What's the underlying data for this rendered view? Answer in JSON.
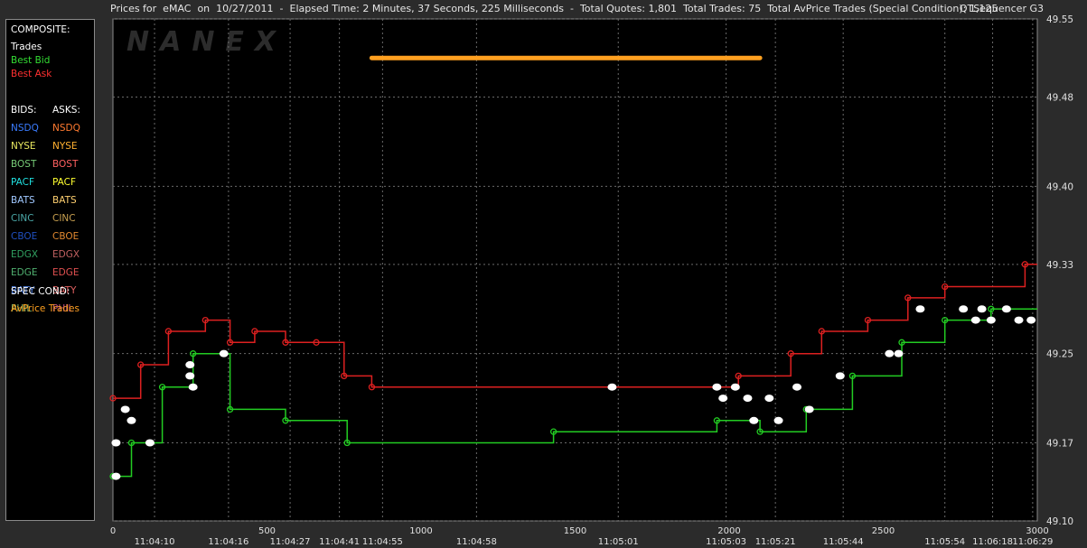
{
  "header": {
    "title": "Prices for  eMAC  on  10/27/2011  -  Elapsed Time: 2 Minutes, 37 Seconds, 225 Milliseconds  -  Total Quotes: 1,801  Total Trades: 75  Total AvPrice Trades (Special Condition): 1,125",
    "app_name": "QTSequencer G3"
  },
  "legend": {
    "composite_label": "COMPOSITE:",
    "composite_items": [
      {
        "label": "Trades",
        "color": "#ffffff"
      },
      {
        "label": "Best Bid",
        "color": "#33dd33"
      },
      {
        "label": "Best Ask",
        "color": "#ff3030"
      }
    ],
    "bids_label": "BIDS:",
    "asks_label": "ASKS:",
    "exchanges": [
      {
        "bid": "NSDQ",
        "bid_color": "#3a7cff",
        "ask": "NSDQ",
        "ask_color": "#ff7a30"
      },
      {
        "bid": "NYSE",
        "bid_color": "#e8e860",
        "ask": "NYSE",
        "ask_color": "#ffb030"
      },
      {
        "bid": "BOST",
        "bid_color": "#77cc77",
        "ask": "BOST",
        "ask_color": "#ff6060"
      },
      {
        "bid": "PACF",
        "bid_color": "#20e0e0",
        "ask": "PACF",
        "ask_color": "#ffff30"
      },
      {
        "bid": "BATS",
        "bid_color": "#a0c8ff",
        "ask": "BATS",
        "ask_color": "#ffd070"
      },
      {
        "bid": "CINC",
        "bid_color": "#4aa6a6",
        "ask": "CINC",
        "ask_color": "#c8a050"
      },
      {
        "bid": "CBOE",
        "bid_color": "#2050c0",
        "ask": "CBOE",
        "ask_color": "#e08830"
      },
      {
        "bid": "EDGX",
        "bid_color": "#30a060",
        "ask": "EDGX",
        "ask_color": "#c06060"
      },
      {
        "bid": "EDGE",
        "bid_color": "#50b070",
        "ask": "EDGE",
        "ask_color": "#e05050"
      },
      {
        "bid": "BATY",
        "bid_color": "#5080e0",
        "ask": "BATY",
        "ask_color": "#e06060"
      },
      {
        "bid": "PHIL",
        "bid_color": "#80b060",
        "ask": "PHIL",
        "ask_color": "#c05080"
      }
    ],
    "spec_cond_label": "SPEC COND:",
    "spec_items": [
      {
        "label": "AvPrice Trades",
        "color": "#ffa020"
      }
    ]
  },
  "watermark": "NANEX",
  "chart_data": {
    "type": "line",
    "ylim": [
      49.1,
      49.55
    ],
    "xlim": [
      0,
      3000
    ],
    "y_ticks": [
      49.55,
      49.48,
      49.4,
      49.33,
      49.25,
      49.17,
      49.1
    ],
    "x_ticks": [
      0,
      500,
      1000,
      1500,
      2000,
      2500,
      3000
    ],
    "time_ticks": [
      {
        "x": 135,
        "label": "11:04:10"
      },
      {
        "x": 375,
        "label": "11:04:16"
      },
      {
        "x": 575,
        "label": "11:04:27"
      },
      {
        "x": 735,
        "label": "11:04:41"
      },
      {
        "x": 875,
        "label": "11:04:55"
      },
      {
        "x": 1180,
        "label": "11:04:58"
      },
      {
        "x": 1640,
        "label": "11:05:01"
      },
      {
        "x": 1990,
        "label": "11:05:03"
      },
      {
        "x": 2150,
        "label": "11:05:21"
      },
      {
        "x": 2370,
        "label": "11:05:44"
      },
      {
        "x": 2700,
        "label": "11:05:54"
      },
      {
        "x": 2855,
        "label": "11:06:18"
      },
      {
        "x": 2985,
        "label": "11:06:29"
      }
    ],
    "grid": true,
    "series": [
      {
        "name": "AvPrice Trades",
        "color": "#ffa020",
        "points": [
          [
            840,
            49.515
          ],
          [
            1180,
            49.515
          ],
          [
            1540,
            49.515
          ],
          [
            1980,
            49.515
          ],
          [
            2100,
            49.515
          ]
        ]
      },
      {
        "name": "Best Ask",
        "color": "#dd2020",
        "points": [
          [
            0,
            49.21
          ],
          [
            90,
            49.21
          ],
          [
            90,
            49.24
          ],
          [
            180,
            49.24
          ],
          [
            180,
            49.27
          ],
          [
            300,
            49.27
          ],
          [
            300,
            49.28
          ],
          [
            380,
            49.28
          ],
          [
            380,
            49.26
          ],
          [
            460,
            49.26
          ],
          [
            460,
            49.27
          ],
          [
            560,
            49.27
          ],
          [
            560,
            49.26
          ],
          [
            660,
            49.26
          ],
          [
            660,
            49.26
          ],
          [
            750,
            49.26
          ],
          [
            750,
            49.23
          ],
          [
            840,
            49.23
          ],
          [
            840,
            49.22
          ],
          [
            2030,
            49.22
          ],
          [
            2030,
            49.23
          ],
          [
            2200,
            49.23
          ],
          [
            2200,
            49.25
          ],
          [
            2300,
            49.25
          ],
          [
            2300,
            49.27
          ],
          [
            2450,
            49.27
          ],
          [
            2450,
            49.28
          ],
          [
            2580,
            49.28
          ],
          [
            2580,
            49.3
          ],
          [
            2700,
            49.3
          ],
          [
            2700,
            49.31
          ],
          [
            2960,
            49.31
          ],
          [
            2960,
            49.33
          ],
          [
            3000,
            49.33
          ]
        ]
      },
      {
        "name": "Best Bid",
        "color": "#22cc22",
        "points": [
          [
            0,
            49.14
          ],
          [
            60,
            49.14
          ],
          [
            60,
            49.17
          ],
          [
            160,
            49.17
          ],
          [
            160,
            49.22
          ],
          [
            260,
            49.22
          ],
          [
            260,
            49.25
          ],
          [
            380,
            49.25
          ],
          [
            380,
            49.2
          ],
          [
            560,
            49.2
          ],
          [
            560,
            49.19
          ],
          [
            760,
            49.19
          ],
          [
            760,
            49.17
          ],
          [
            1430,
            49.17
          ],
          [
            1430,
            49.18
          ],
          [
            1960,
            49.18
          ],
          [
            1960,
            49.19
          ],
          [
            2100,
            49.19
          ],
          [
            2100,
            49.18
          ],
          [
            2250,
            49.18
          ],
          [
            2250,
            49.2
          ],
          [
            2400,
            49.2
          ],
          [
            2400,
            49.23
          ],
          [
            2560,
            49.23
          ],
          [
            2560,
            49.26
          ],
          [
            2700,
            49.26
          ],
          [
            2700,
            49.28
          ],
          [
            2850,
            49.28
          ],
          [
            2850,
            49.29
          ],
          [
            3000,
            49.29
          ]
        ]
      },
      {
        "name": "Trades",
        "color": "#ffffff",
        "points": [
          [
            10,
            49.17
          ],
          [
            10,
            49.14
          ],
          [
            40,
            49.2
          ],
          [
            60,
            49.19
          ],
          [
            120,
            49.17
          ],
          [
            250,
            49.23
          ],
          [
            250,
            49.24
          ],
          [
            260,
            49.22
          ],
          [
            360,
            49.25
          ],
          [
            1620,
            49.22
          ],
          [
            1960,
            49.22
          ],
          [
            1980,
            49.21
          ],
          [
            2020,
            49.22
          ],
          [
            2060,
            49.21
          ],
          [
            2080,
            49.19
          ],
          [
            2130,
            49.21
          ],
          [
            2160,
            49.19
          ],
          [
            2220,
            49.22
          ],
          [
            2260,
            49.2
          ],
          [
            2360,
            49.23
          ],
          [
            2520,
            49.25
          ],
          [
            2550,
            49.25
          ],
          [
            2620,
            49.29
          ],
          [
            2760,
            49.29
          ],
          [
            2800,
            49.28
          ],
          [
            2820,
            49.29
          ],
          [
            2850,
            49.28
          ],
          [
            2900,
            49.29
          ],
          [
            2940,
            49.28
          ],
          [
            2980,
            49.28
          ]
        ]
      }
    ]
  }
}
